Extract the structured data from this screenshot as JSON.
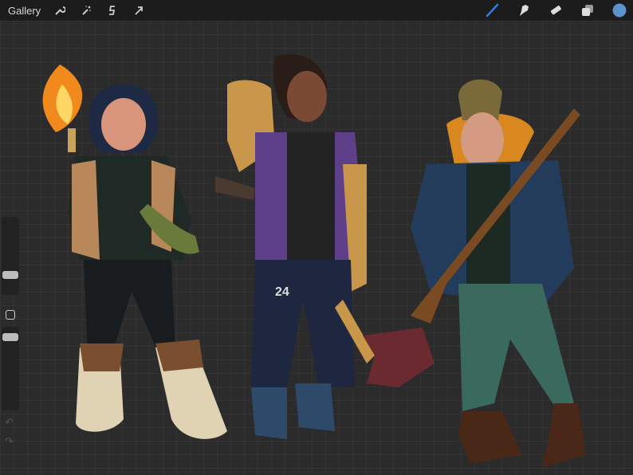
{
  "topbar": {
    "gallery_label": "Gallery",
    "left_tools": [
      "wrench-icon",
      "magic-wand-icon",
      "selection-icon",
      "transform-arrow-icon"
    ],
    "right_tools": [
      "brush-icon",
      "smudge-icon",
      "eraser-icon",
      "layers-icon",
      "color-picker"
    ]
  },
  "colors": {
    "current_color": "#5b94cc",
    "active_tool": "#2f7de1"
  },
  "sidebar": {
    "brush_size_fraction": 0.3,
    "opacity_fraction": 0.9,
    "undo": "↶",
    "redo": "↷"
  },
  "canvas": {
    "jersey_number": "24"
  }
}
